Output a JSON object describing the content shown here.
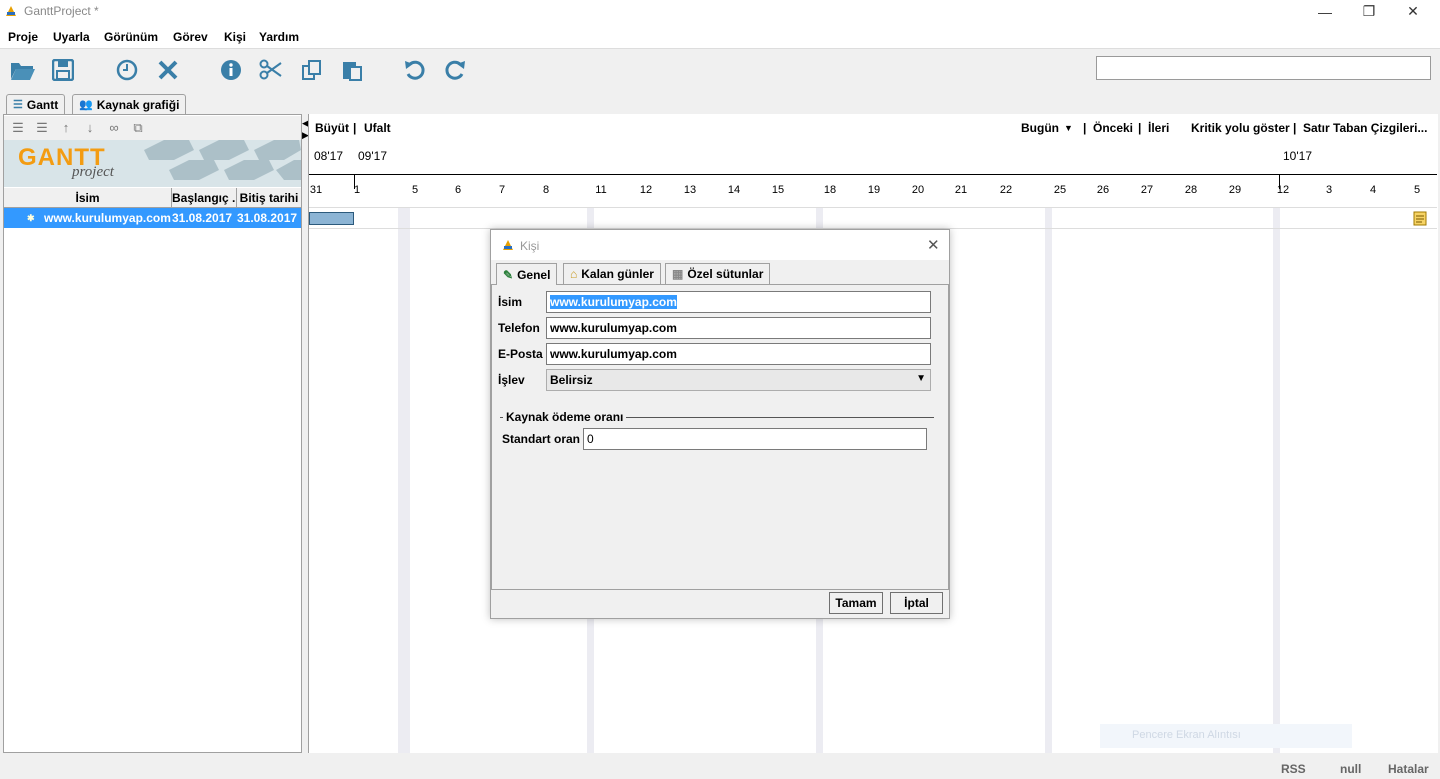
{
  "window": {
    "title": "GanttProject *",
    "controls": {
      "minimize": "—",
      "maximize": "❐",
      "close": "✕"
    }
  },
  "menu": [
    "Proje",
    "Uyarla",
    "Görünüm",
    "Görev",
    "Kişi",
    "Yardım"
  ],
  "toolbar": {
    "icons": [
      "open-icon",
      "save-icon",
      "clock-icon",
      "delete-icon",
      "info-icon",
      "cut-icon",
      "copy-icon",
      "paste-icon",
      "undo-icon",
      "redo-icon"
    ],
    "search": {
      "value": "",
      "placeholder": ""
    }
  },
  "tabs": [
    {
      "label": "Gantt",
      "active": true
    },
    {
      "label": "Kaynak grafiği",
      "active": false
    }
  ],
  "logo": {
    "text_main": "GANTT",
    "text_sub": "project"
  },
  "task_table": {
    "headers": [
      "İsim",
      "Başlangıç ...",
      "Bitiş tarihi"
    ],
    "rows": [
      {
        "name": "www.kurulumyap.com",
        "start": "31.08.2017",
        "end": "31.08.2017"
      }
    ]
  },
  "chart_toolbar": {
    "zoom_in": "Büyüt",
    "zoom_out": "Ufalt",
    "today": "Bugün",
    "prev": "Önceki",
    "next": "İleri",
    "critical_path": "Kritik yolu göster",
    "baselines": "Satır Taban Çizgileri..."
  },
  "timeline": {
    "months": [
      "08'17",
      "09'17",
      "10'17"
    ],
    "days": [
      "31",
      "1",
      "5",
      "6",
      "7",
      "8",
      "11",
      "12",
      "13",
      "14",
      "15",
      "18",
      "19",
      "20",
      "21",
      "22",
      "25",
      "26",
      "27",
      "28",
      "29",
      "12",
      "3",
      "4",
      "5"
    ]
  },
  "dialog": {
    "title": "Kişi",
    "tabs": [
      "Genel",
      "Kalan günler",
      "Özel sütunlar"
    ],
    "fields": {
      "name_label": "İsim",
      "name_value": "www.kurulumyap.com",
      "phone_label": "Telefon",
      "phone_value": "www.kurulumyap.com",
      "email_label": "E-Posta",
      "email_value": "www.kurulumyap.com",
      "role_label": "İşlev",
      "role_value": "Belirsiz"
    },
    "rate_section": {
      "title": "Kaynak ödeme oranı",
      "standard_label": "Standart oran",
      "standard_value": "0"
    },
    "buttons": {
      "ok": "Tamam",
      "cancel": "İptal"
    }
  },
  "status": [
    "RSS",
    "null",
    "Hatalar"
  ],
  "ghost_text": "Pencere Ekran Alıntısı"
}
